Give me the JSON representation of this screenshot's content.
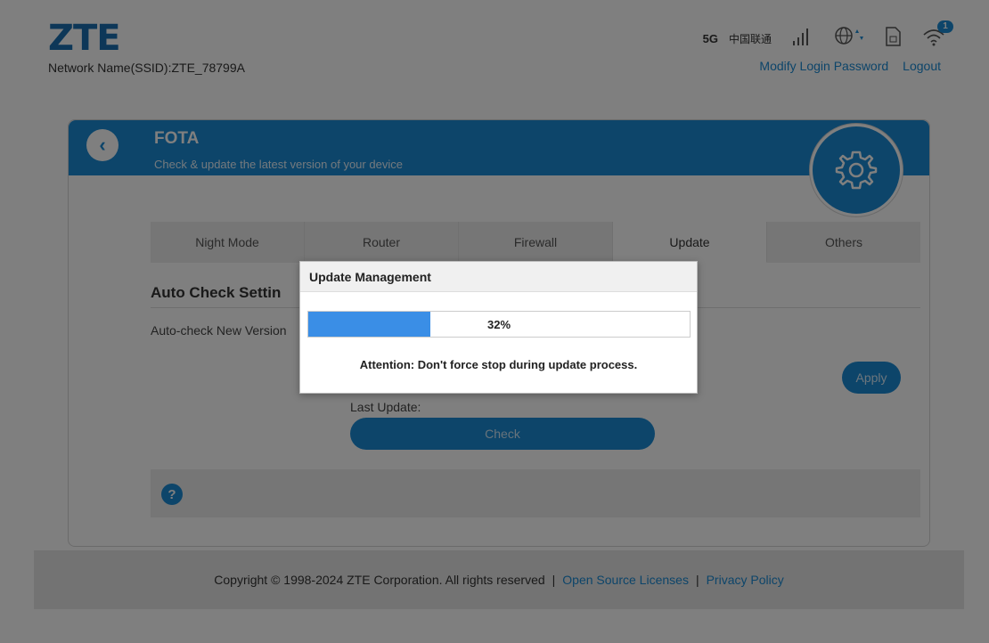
{
  "header": {
    "logo": "ZTE",
    "ssid": "Network Name(SSID):ZTE_78799A",
    "network_type": "5G",
    "carrier": "中国联通",
    "wifi_badge": "1",
    "modify_password": "Modify Login Password",
    "logout": "Logout"
  },
  "card": {
    "title": "FOTA",
    "subtitle": "Check & update the latest version of your device",
    "tabs": [
      {
        "label": "Night Mode"
      },
      {
        "label": "Router"
      },
      {
        "label": "Firewall"
      },
      {
        "label": "Update"
      },
      {
        "label": "Others"
      }
    ],
    "active_tab": "Update",
    "section_title": "Auto Check Settin",
    "auto_check_label": "Auto-check New Version",
    "apply_label": "Apply",
    "last_update_label": "Last Update:",
    "check_label": "Check",
    "help_label": "?"
  },
  "modal": {
    "title": "Update Management",
    "progress_text": "32%",
    "progress_value": 0.32,
    "note": "Attention: Don't force stop during update process."
  },
  "footer": {
    "copyright": "Copyright © 1998-2024 ZTE Corporation. All rights reserved",
    "separator": "|",
    "open_source": "Open Source Licenses",
    "privacy": "Privacy Policy"
  },
  "colors": {
    "accent": "#1a8ad4",
    "progress": "#3a8ee6"
  }
}
